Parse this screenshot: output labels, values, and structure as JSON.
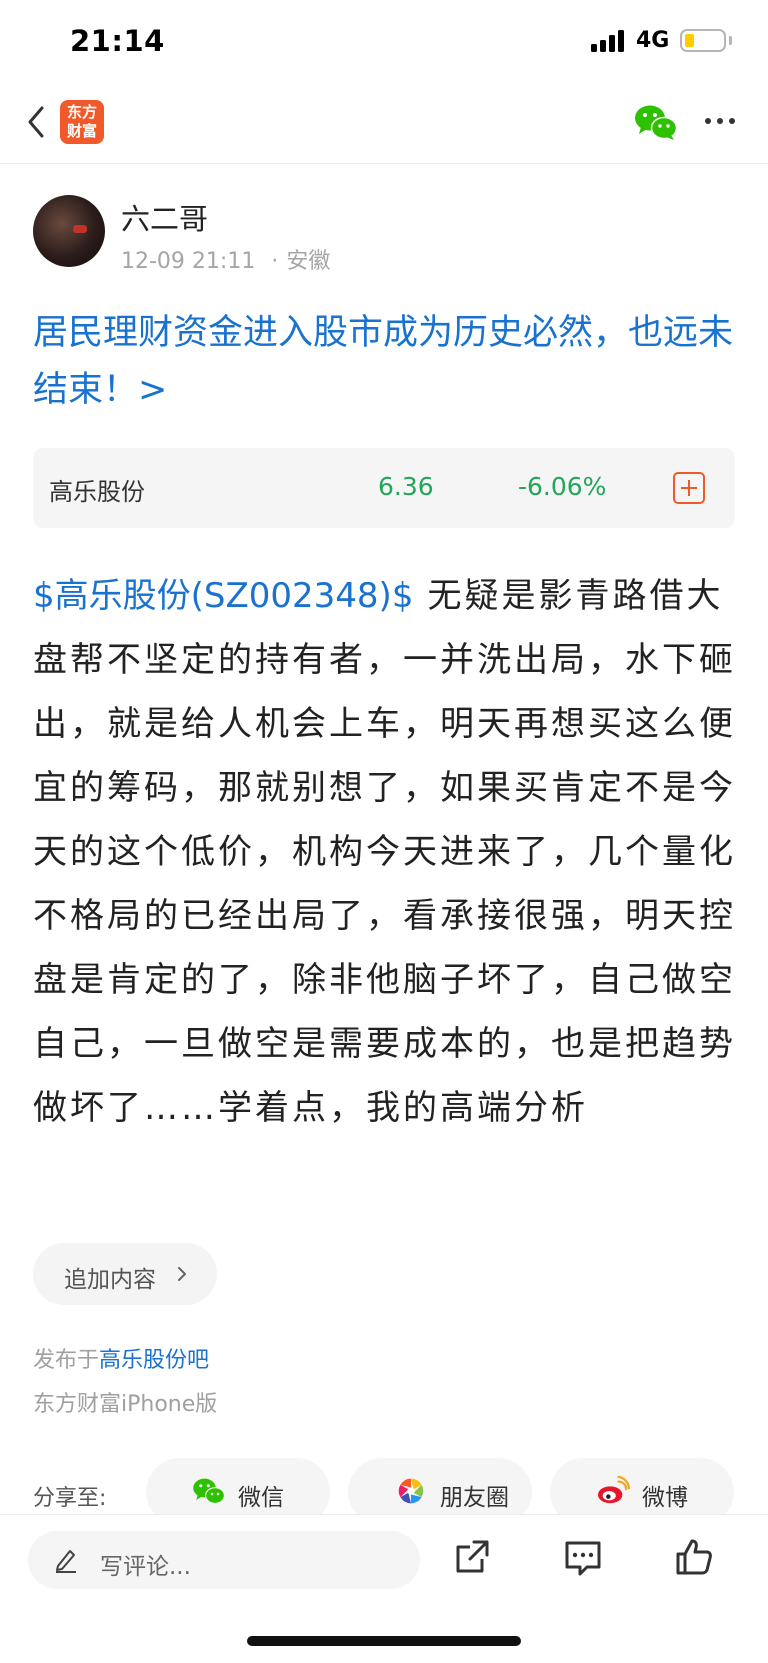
{
  "status_bar": {
    "time": "21:14",
    "network": "4G"
  },
  "nav": {
    "logo_text": "东方财富"
  },
  "author": {
    "name": "六二哥",
    "time": "12-09 21:11",
    "location": "安徽"
  },
  "headline": "居民理财资金进入股市成为历史必然，也远未结束！>",
  "stock": {
    "name": "高乐股份",
    "price": "6.36",
    "change": "-6.06%",
    "color": "#23a55a"
  },
  "post": {
    "stock_link": "$高乐股份(SZ002348)$",
    "text": "无疑是影青路借大盘帮不坚定的持有者，一并洗出局，水下砸出，就是给人机会上车，明天再想买这么便宜的筹码，那就别想了，如果买肯定不是今天的这个低价，机构今天进来了，几个量化不格局的已经出局了，看承接很强，明天控盘是肯定的了，除非他脑子坏了，自己做空自己，一旦做空是需要成本的，也是把趋势做坏了……学着点，我的高端分析"
  },
  "append_label": "追加内容",
  "published": {
    "prefix": "发布于",
    "forum": "高乐股份吧",
    "client": "东方财富iPhone版"
  },
  "share": {
    "label": "分享至:",
    "items": [
      {
        "label": "微信",
        "icon": "wechat-icon"
      },
      {
        "label": "朋友圈",
        "icon": "moments-icon"
      },
      {
        "label": "微博",
        "icon": "weibo-icon"
      }
    ]
  },
  "bottom_bar": {
    "comment_placeholder": "写评论..."
  },
  "colors": {
    "brand": "#f0592a",
    "link": "#1a72cf",
    "down": "#23a55a"
  }
}
